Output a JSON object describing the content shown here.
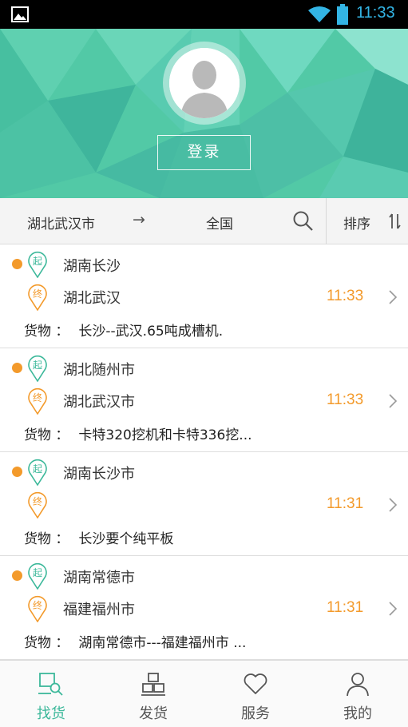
{
  "status_bar": {
    "time": "11:33"
  },
  "header": {
    "login_label": "登录"
  },
  "filter_bar": {
    "from": "湖北武汉市",
    "arrow": "→",
    "to": "全国",
    "sort_label": "排序"
  },
  "pin_labels": {
    "start": "起",
    "end": "终"
  },
  "cargo_label": "货物 ：",
  "orders": [
    {
      "origin": "湖南长沙",
      "dest": "湖北武汉",
      "time": "11:33",
      "cargo": "长沙--武汉.65吨成槽机."
    },
    {
      "origin": "湖北随州市",
      "dest": "湖北武汉市",
      "time": "11:33",
      "cargo": "卡特320挖机和卡特336挖..."
    },
    {
      "origin": "湖南长沙市",
      "dest": "",
      "time": "11:31",
      "cargo": "长沙要个纯平板"
    },
    {
      "origin": "湖南常德市",
      "dest": "福建福州市",
      "time": "11:31",
      "cargo": "湖南常德市---福建福州市 ..."
    }
  ],
  "bottom_nav": [
    {
      "label": "找货",
      "icon": "find-cargo-icon",
      "active": true
    },
    {
      "label": "发货",
      "icon": "ship-cargo-icon",
      "active": false
    },
    {
      "label": "服务",
      "icon": "heart-icon",
      "active": false
    },
    {
      "label": "我的",
      "icon": "person-icon",
      "active": false
    }
  ],
  "colors": {
    "accent": "#3cb89a",
    "time_orange": "#f39a2b",
    "status_blue": "#33b5e5"
  }
}
